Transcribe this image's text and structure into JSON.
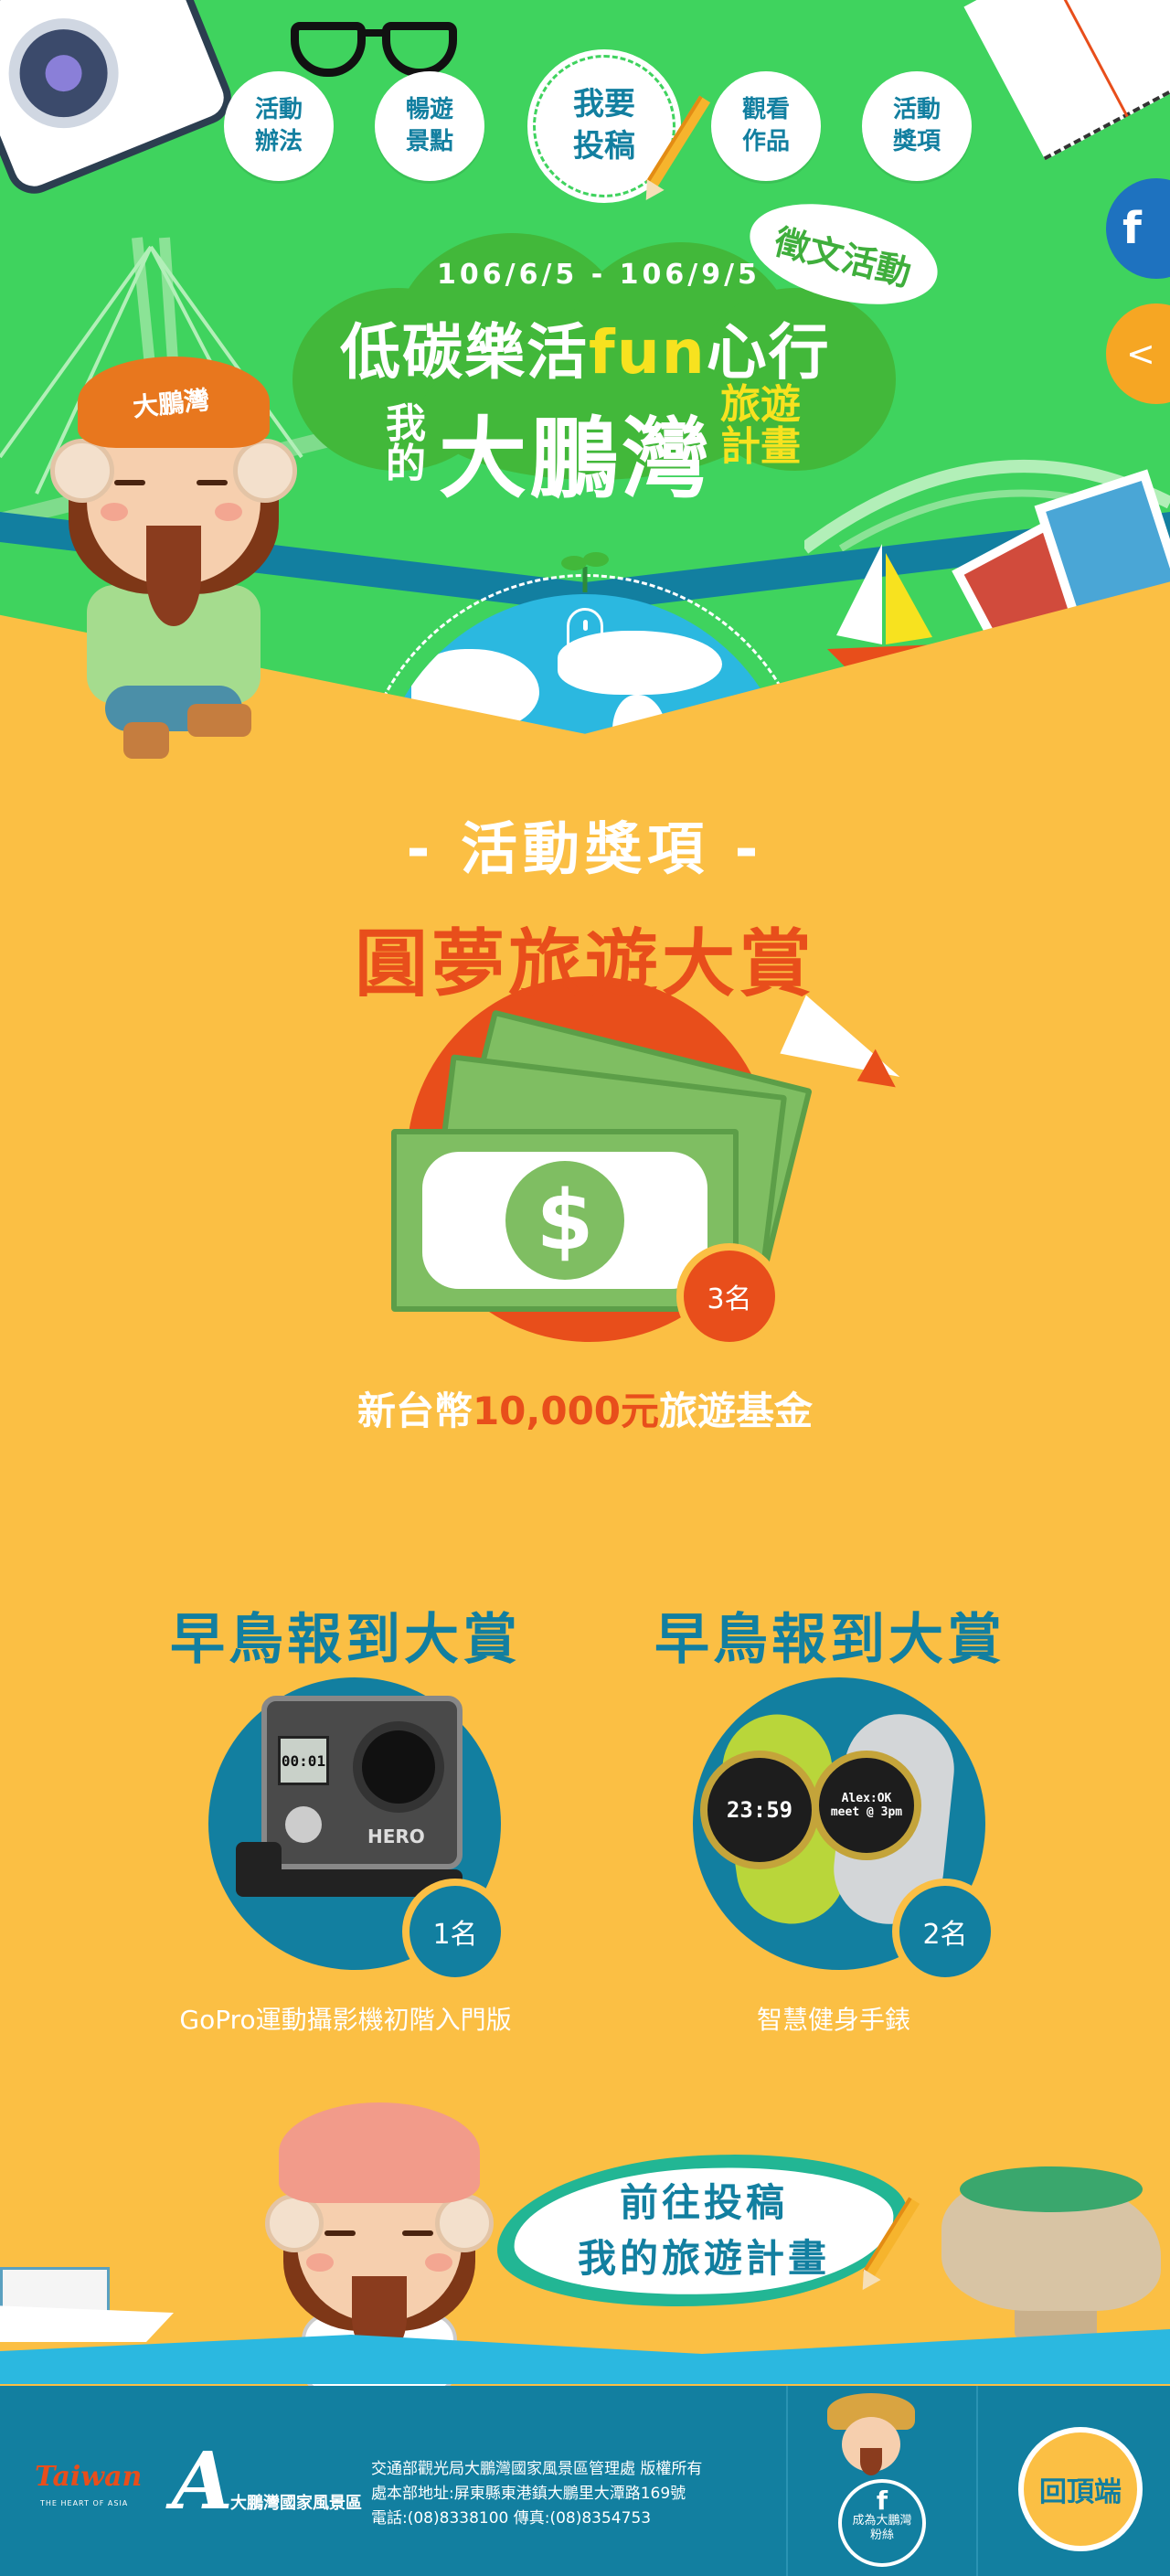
{
  "nav": {
    "items": [
      {
        "label": "活動\n辦法"
      },
      {
        "label": "暢遊\n景點"
      },
      {
        "label": "我要\n投稿"
      },
      {
        "label": "觀看\n作品"
      },
      {
        "label": "活動\n獎項"
      }
    ]
  },
  "social": {
    "facebook_icon": "facebook-icon",
    "share_icon": "share-icon"
  },
  "hero": {
    "badge": "徵文活動",
    "date": "106/6/5 - 106/9/5",
    "title_part1": "低碳樂活",
    "title_fun": "fun",
    "title_part2": "心行",
    "title_my": "我\n的",
    "title_place": "大鵬灣",
    "title_plan": "旅遊\n計畫",
    "cap_text": "大鵬灣"
  },
  "prizes": {
    "heading": "- 活動獎項 -",
    "grand": {
      "title": "圓夢旅遊大賞",
      "count": "3名",
      "desc_prefix": "新台幣",
      "desc_amount": "10,000元",
      "desc_suffix": "旅遊基金"
    },
    "early_1": {
      "title": "早鳥報到大賞",
      "count": "1名",
      "desc": "GoPro運動攝影機初階入門版",
      "camera_brand": "HERO",
      "lcd_text": "00:01"
    },
    "early_2": {
      "title": "早鳥報到大賞",
      "count": "2名",
      "desc": "智慧健身手錶",
      "watch_1": "23:59",
      "watch_2": "Alex:OK\nmeet @ 3pm"
    }
  },
  "cta": {
    "label": "前往投稿\n我的旅遊計畫"
  },
  "footer": {
    "taiwan_logo": "Taiwan",
    "taiwan_slogan": "THE HEART OF ASIA",
    "agency_logo": "大鵬灣國家風景區",
    "lines": [
      "交通部觀光局大鵬灣國家風景區管理處 版權所有",
      "處本部地址:屏東縣東港鎮大鵬里大潭路169號",
      "電話:(08)8338100 傳真:(08)8354753"
    ],
    "fan_label": "成為大鵬灣\n粉絲",
    "fan_icon_text": "f",
    "back_to_top": "回頂端"
  },
  "colors": {
    "green": "#3fd35e",
    "yellow": "#fbbf44",
    "teal": "#127fa0",
    "orange": "#e84e1b",
    "money_green": "#7fbe62"
  }
}
